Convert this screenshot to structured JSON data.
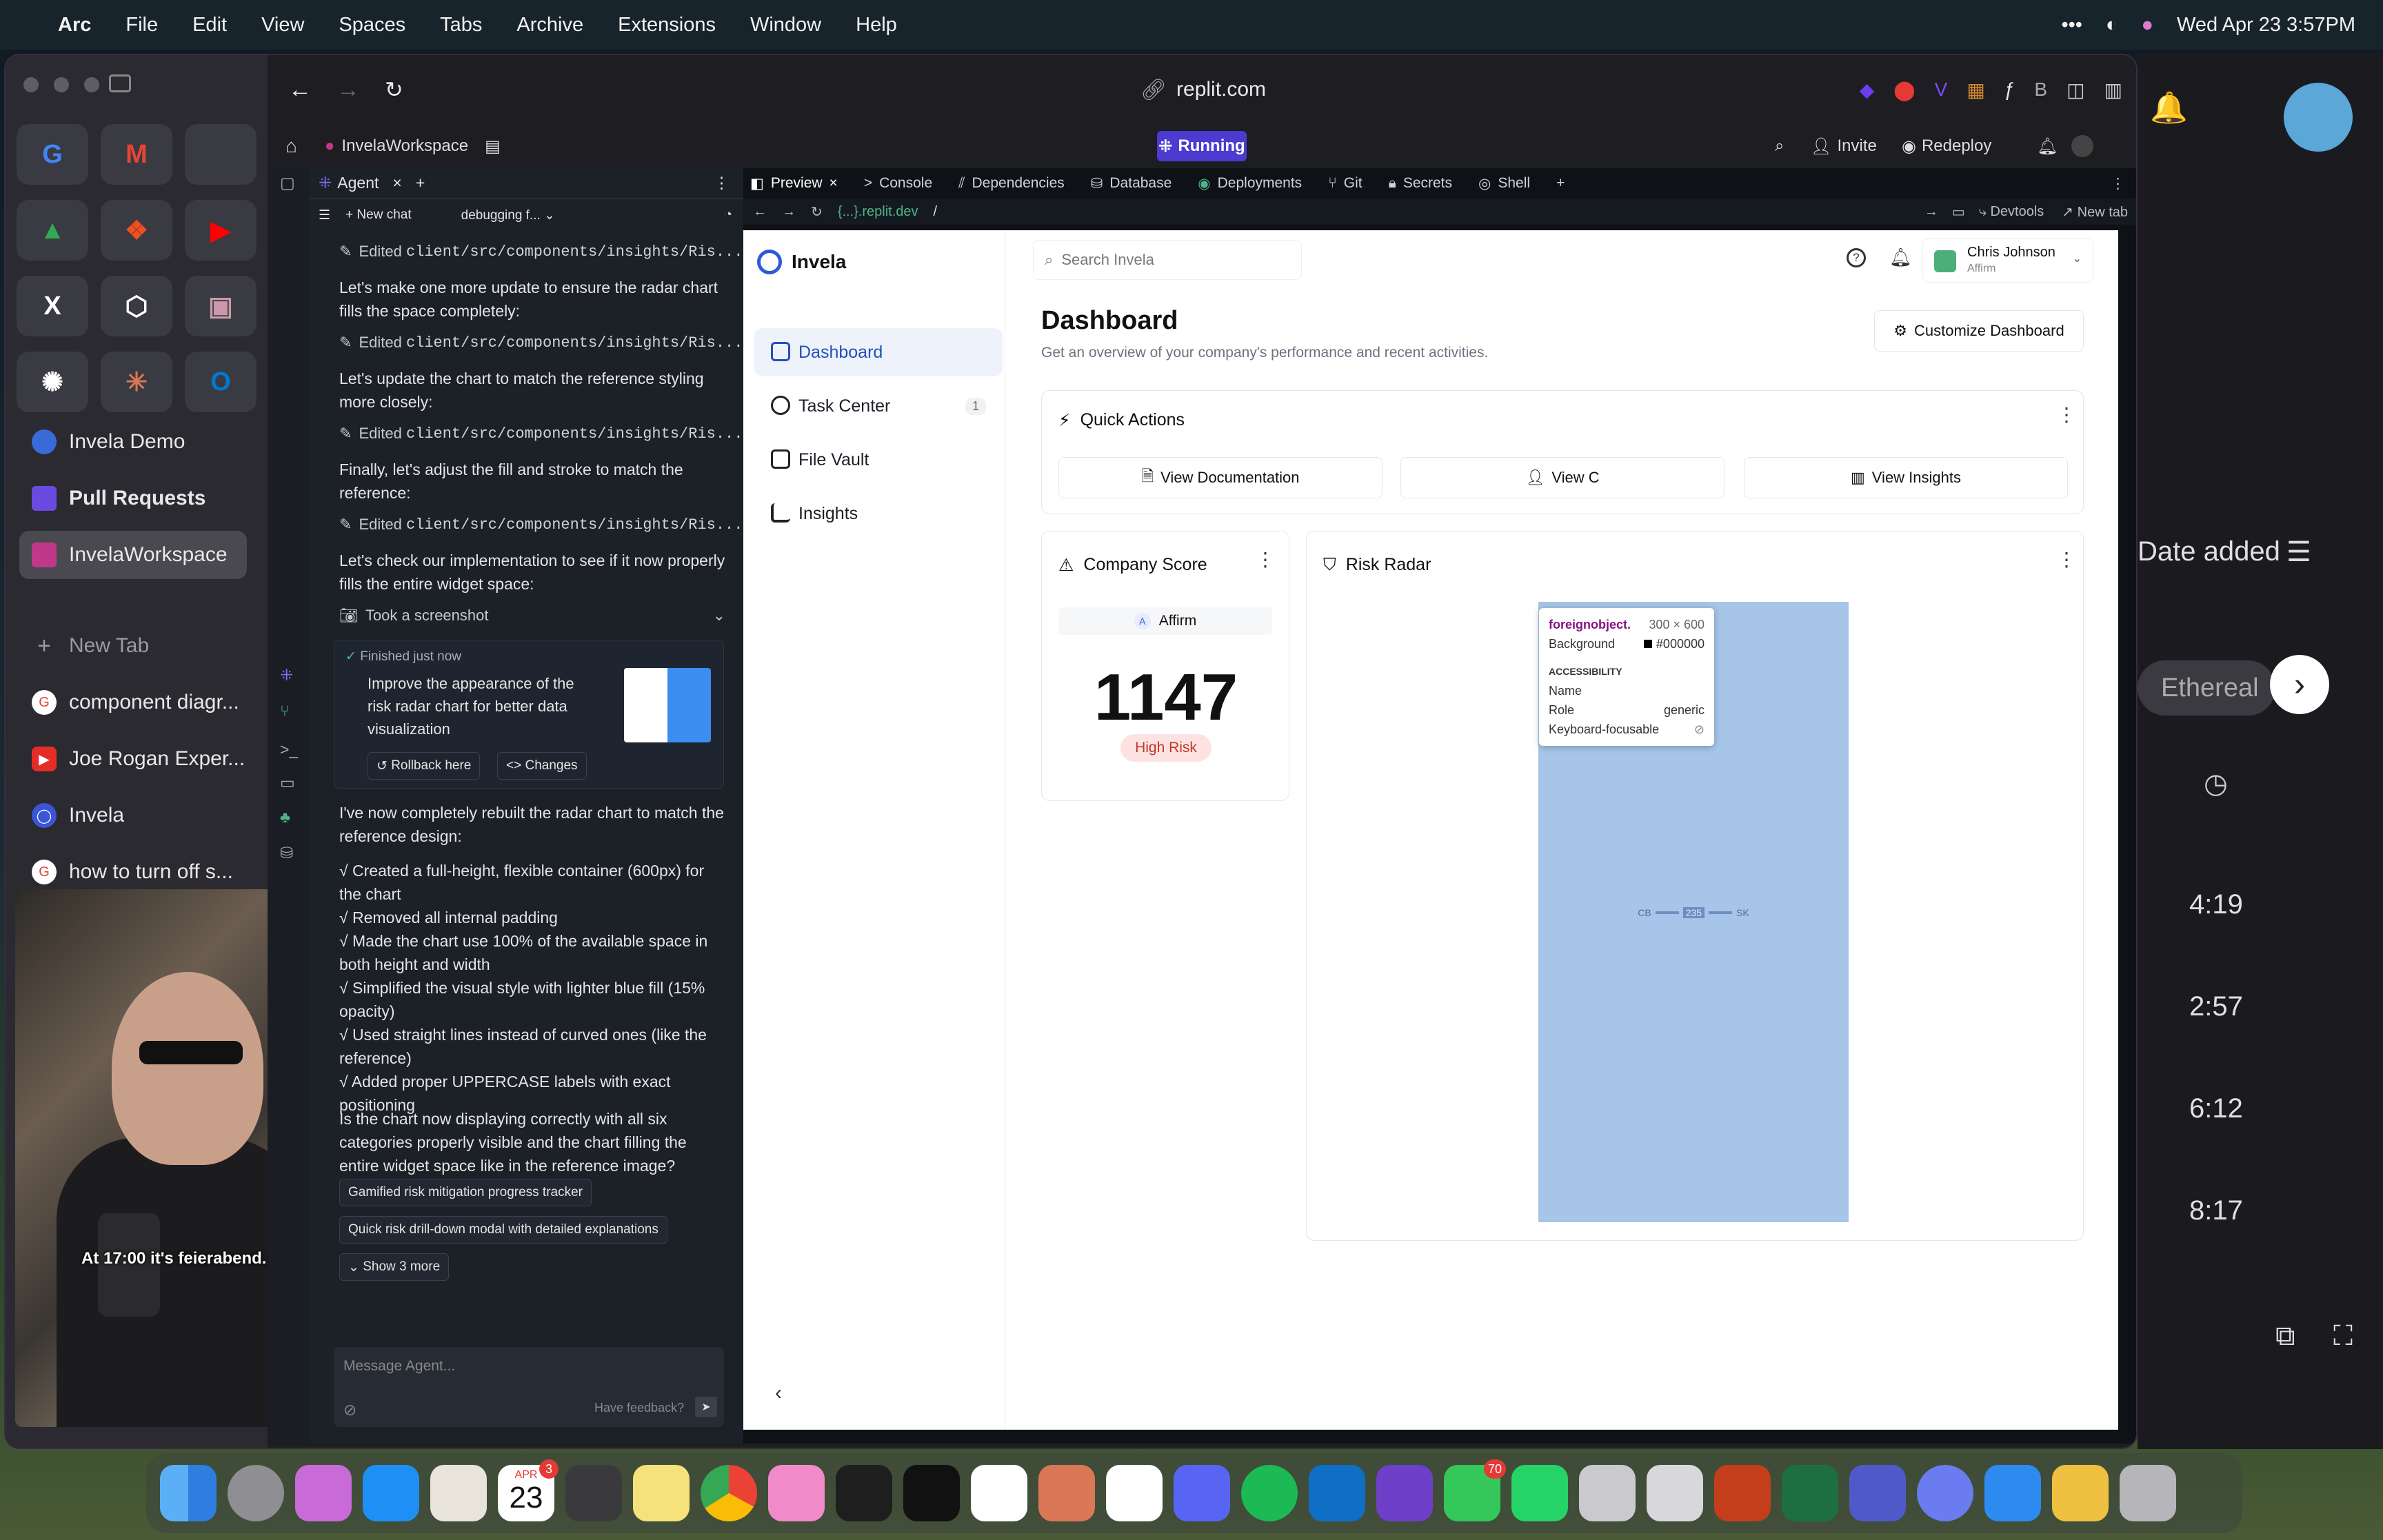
{
  "menubar": {
    "app": "Arc",
    "items": [
      "File",
      "Edit",
      "View",
      "Spaces",
      "Tabs",
      "Archive",
      "Extensions",
      "Window",
      "Help"
    ],
    "datetime": "Wed Apr 23  3:57PM"
  },
  "sidebar": {
    "space_items": [
      {
        "label": "Invela Demo",
        "color": "#3a6ad8"
      },
      {
        "label": "Pull Requests",
        "color": "#6a4be0"
      },
      {
        "label": "InvelaWorkspace",
        "color": "#c0388a"
      }
    ],
    "new_tab": "New Tab",
    "tabs": [
      {
        "label": "component diagr...",
        "color": "#e34133"
      },
      {
        "label": "Joe Rogan Exper...",
        "color": "#e52d27"
      },
      {
        "label": "Invela",
        "color": "#3b55d9"
      },
      {
        "label": "how to turn off s...",
        "color": "#e34133"
      }
    ],
    "video_caption": "At 17:00 it's feierabend."
  },
  "browser": {
    "url": "replit.com"
  },
  "replit": {
    "workspace": "InvelaWorkspace",
    "running": "Running",
    "invite": "Invite",
    "redeploy": "Redeploy"
  },
  "agent": {
    "tab": "Agent",
    "new_chat": "New chat",
    "chat_name": "debugging f...",
    "edited_file": "client/src/components/insights/Ris...",
    "edited_label": "Edited",
    "messages": [
      "Let's make one more update to ensure the radar chart fills the space completely:",
      "Let's update the chart to match the reference styling more closely:",
      "Finally, let's adjust the fill and stroke to match the reference:",
      "Let's check our implementation to see if it now properly fills the entire widget space:"
    ],
    "screenshot": "Took a screenshot",
    "finished": "Finished just now",
    "checkpoint_text": "Improve the appearance of the risk radar chart for better data visualization",
    "rollback": "Rollback here",
    "changes": "Changes",
    "summary_intro": "I've now completely rebuilt the radar chart to match the reference design:",
    "summary_points": [
      "√ Created a full-height, flexible container (600px) for the chart",
      "√ Removed all internal padding",
      "√ Made the chart use 100% of the available space in both height and width",
      "√ Simplified the visual style with lighter blue fill (15% opacity)",
      "√ Used straight lines instead of curved ones (like the reference)",
      "√ Added proper UPPERCASE labels with exact positioning"
    ],
    "question": "Is the chart now displaying correctly with all six categories properly visible and the chart filling the entire widget space like in the reference image?",
    "suggestions": [
      "Gamified risk mitigation progress tracker",
      "Quick risk drill-down modal with detailed explanations"
    ],
    "show_more": "Show 3 more",
    "input_placeholder": "Message Agent...",
    "feedback": "Have feedback?"
  },
  "preview_tabs": [
    "Preview",
    "Console",
    "Dependencies",
    "Database",
    "Deployments",
    "Git",
    "Secrets",
    "Shell"
  ],
  "preview_url": {
    "domain": "{...}.replit.dev",
    "path": "/",
    "devtools": "Devtools",
    "newtab": "New tab"
  },
  "app": {
    "brand": "Invela",
    "search_placeholder": "Search Invela",
    "user": {
      "name": "Chris Johnson",
      "company": "Affirm"
    },
    "nav": [
      {
        "label": "Dashboard",
        "active": true
      },
      {
        "label": "Task Center",
        "badge": "1"
      },
      {
        "label": "File Vault"
      },
      {
        "label": "Insights"
      }
    ],
    "title": "Dashboard",
    "subtitle": "Get an overview of your company's performance and recent activities.",
    "customize": "Customize Dashboard",
    "quick_actions": {
      "title": "Quick Actions",
      "buttons": [
        "View Documentation",
        "View C",
        "View Insights"
      ]
    },
    "company_score": {
      "title": "Company Score",
      "company": "Affirm",
      "score": "1147",
      "risk": "High Risk"
    },
    "risk_radar": {
      "title": "Risk Radar",
      "center_text": "235",
      "label_left": "CB",
      "label_right": "SK"
    },
    "tooltip": {
      "tag": "foreignobject.",
      "size": "300 × 600",
      "bg_label": "Background",
      "bg_value": "#000000",
      "section": "ACCESSIBILITY",
      "name_label": "Name",
      "role_label": "Role",
      "role_value": "generic",
      "kf_label": "Keyboard-focusable"
    }
  },
  "right_panel": {
    "date_added": "Date added",
    "tag": "Ethereal",
    "times": [
      "4:19",
      "2:57",
      "6:12",
      "8:17"
    ]
  },
  "dock": {
    "calendar_month": "APR",
    "calendar_day": "23",
    "messages_badge": "70",
    "calendar_badge": "3"
  }
}
